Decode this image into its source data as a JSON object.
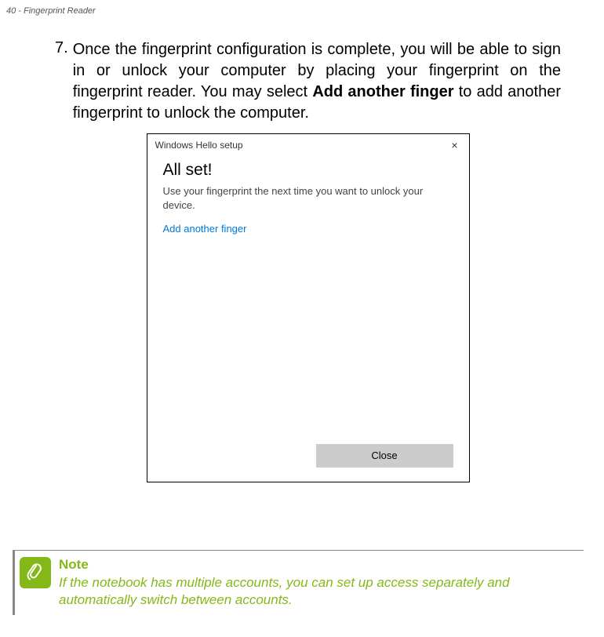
{
  "header": {
    "running_head": "40 - Fingerprint Reader"
  },
  "step": {
    "number": "7.",
    "text_before_bold": "Once the fingerprint configuration is complete, you will be able to sign in or unlock your computer by placing your fingerprint on the fingerprint reader.  You may select ",
    "bold_text": "Add another finger",
    "text_after_bold": " to add another fingerprint to unlock the computer."
  },
  "dialog": {
    "title": "Windows Hello setup",
    "close_symbol": "×",
    "heading": "All set!",
    "subtext": "Use your fingerprint the next time you want to unlock your device.",
    "link": "Add another finger",
    "close_button": "Close"
  },
  "note": {
    "title": "Note",
    "body": "If the notebook has multiple accounts, you can set up access separately and automatically switch between accounts."
  }
}
